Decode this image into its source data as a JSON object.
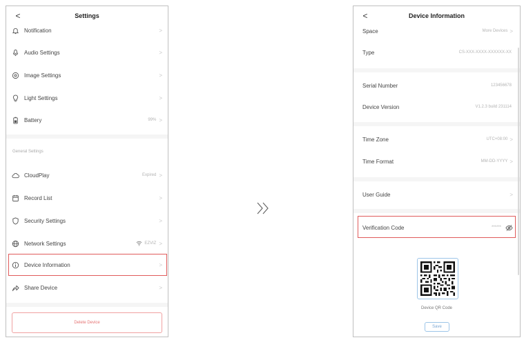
{
  "left_screen": {
    "back_glyph": "<",
    "title": "Settings",
    "items": [
      {
        "label": "Notification",
        "value": "",
        "chevron": ">"
      },
      {
        "label": "Audio Settings",
        "value": "",
        "chevron": ">"
      },
      {
        "label": "Image Settings",
        "value": "",
        "chevron": ">"
      },
      {
        "label": "Light Settings",
        "value": "",
        "chevron": ">"
      },
      {
        "label": "Battery",
        "value": "99%",
        "chevron": ">"
      }
    ],
    "section_title": "General Settings",
    "general_items": [
      {
        "label": "CloudPlay",
        "value": "Expired",
        "chevron": ">"
      },
      {
        "label": "Record List",
        "value": "",
        "chevron": ">"
      },
      {
        "label": "Security Settings",
        "value": "",
        "chevron": ">"
      },
      {
        "label": "Network Settings",
        "value": "EZVIZ",
        "chevron": ">"
      },
      {
        "label": "Device Information",
        "value": "",
        "chevron": ">"
      },
      {
        "label": "Share Device",
        "value": "",
        "chevron": ">"
      }
    ],
    "delete_label": "Delete Device"
  },
  "right_screen": {
    "back_glyph": "<",
    "title": "Device Information",
    "rows": {
      "space": {
        "label": "Space",
        "value": "More Devices",
        "chevron": ">"
      },
      "type": {
        "label": "Type",
        "value": "CS-XXX-XXXX-XXXXXX-XX"
      },
      "serial": {
        "label": "Serial Number",
        "value": "123456678"
      },
      "version": {
        "label": "Device Version",
        "value": "V1.2.3 build 231114"
      },
      "timezone": {
        "label": "Time Zone",
        "value": "UTC+08:00",
        "chevron": ">"
      },
      "timeformat": {
        "label": "Time Format",
        "value": "MM-DD-YYYY",
        "chevron": ">"
      },
      "guide": {
        "label": "User Guide",
        "value": "",
        "chevron": ">"
      },
      "verification": {
        "label": "Verification Code",
        "value": "******"
      }
    },
    "qr_label": "Device QR Code",
    "save_label": "Save"
  },
  "transition_glyph": "»",
  "colors": {
    "highlight": "#e05a5a",
    "accent_blue": "#9cc5e8",
    "delete_red": "#e57373"
  },
  "icons": [
    "bell-icon",
    "microphone-icon",
    "image-settings-icon",
    "lightbulb-icon",
    "battery-icon",
    "cloud-icon",
    "record-list-icon",
    "shield-icon",
    "globe-icon",
    "info-icon",
    "share-icon",
    "wifi-icon",
    "eye-off-icon",
    "qr-code-icon"
  ]
}
